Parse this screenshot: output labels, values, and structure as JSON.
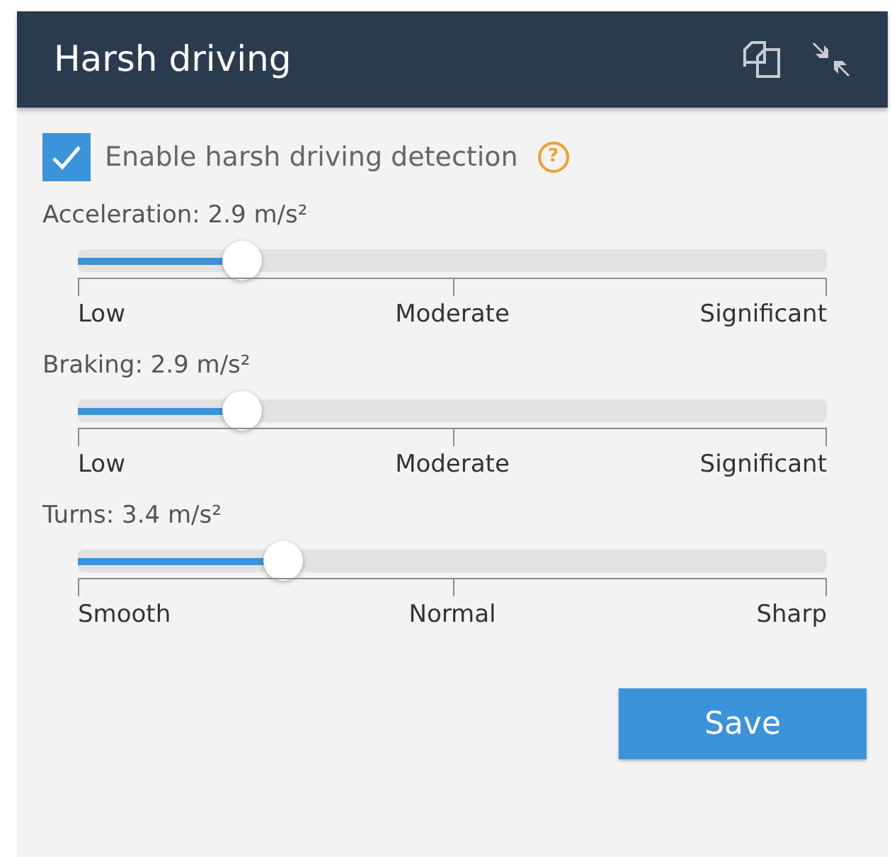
{
  "window": {
    "title": "Harsh driving"
  },
  "enable": {
    "label": "Enable harsh driving detection",
    "checked": true,
    "help": "?"
  },
  "sliders": [
    {
      "label": "Acceleration: 2.9 m/s²",
      "level": 0.22,
      "scale": [
        "Low",
        "Moderate",
        "Significant"
      ]
    },
    {
      "label": "Braking: 2.9 m/s²",
      "level": 0.22,
      "scale": [
        "Low",
        "Moderate",
        "Significant"
      ]
    },
    {
      "label": "Turns: 3.4 m/s²",
      "level": 0.275,
      "scale": [
        "Smooth",
        "Normal",
        "Sharp"
      ]
    }
  ],
  "buttons": [
    "Save"
  ]
}
